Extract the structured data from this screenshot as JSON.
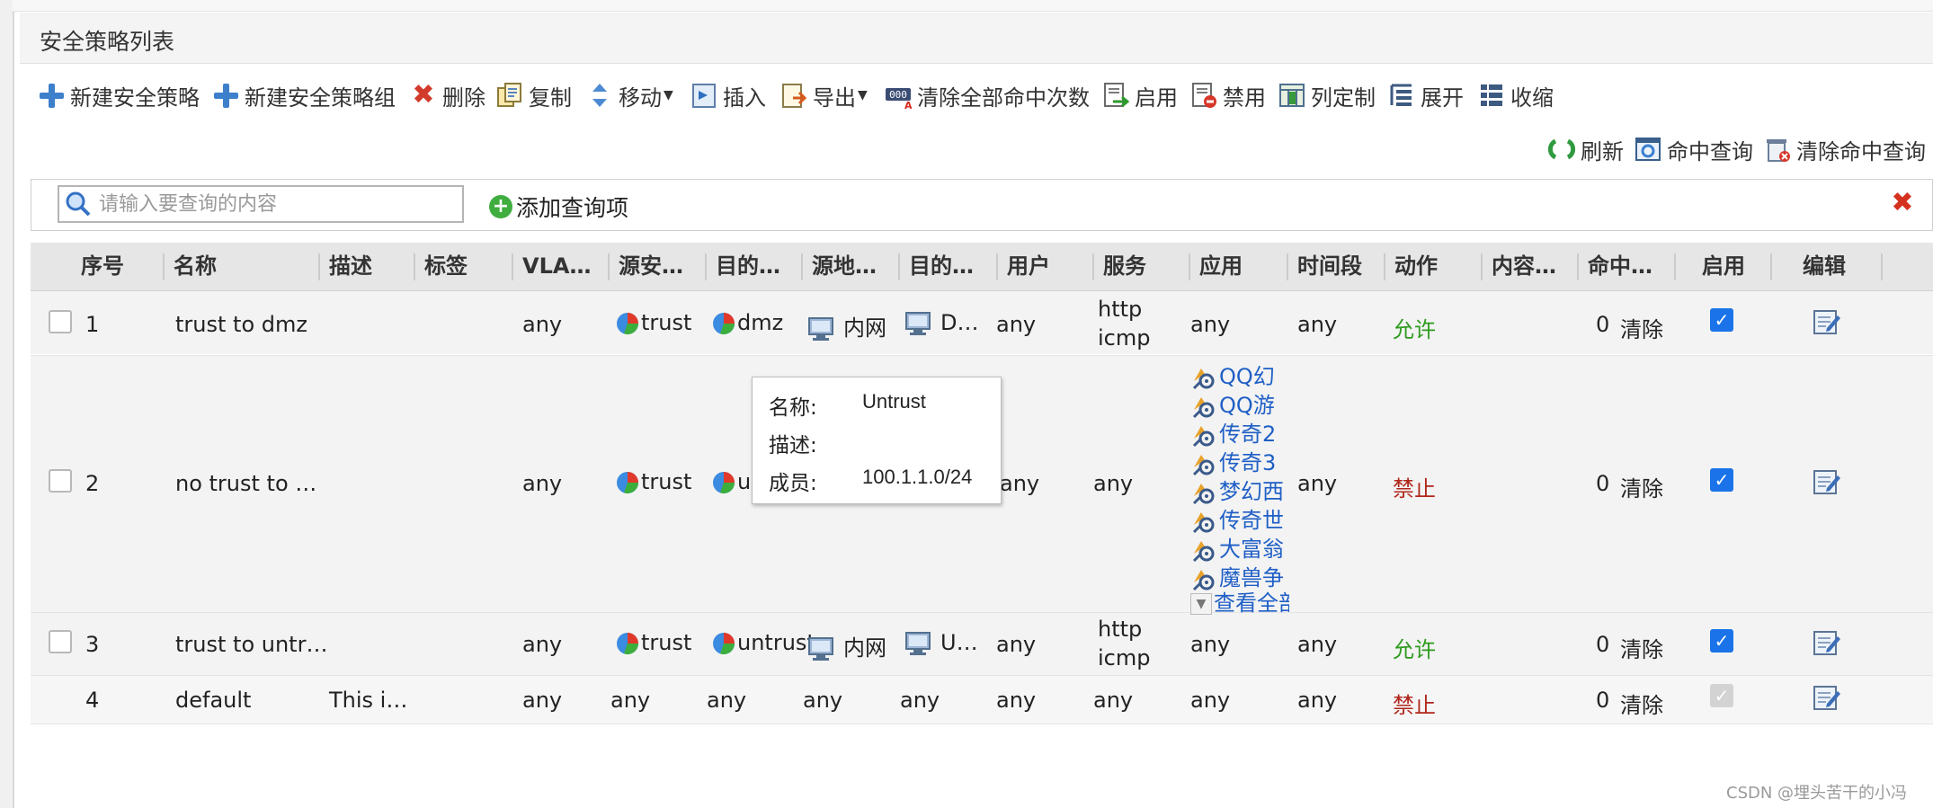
{
  "panel": {
    "title": "安全策略列表"
  },
  "toolbar": {
    "new_policy": "新建安全策略",
    "new_policy_group": "新建安全策略组",
    "delete": "删除",
    "copy": "复制",
    "move": "移动",
    "insert": "插入",
    "export": "导出",
    "clear_all_hits": "清除全部命中次数",
    "enable": "启用",
    "disable": "禁用",
    "customize_columns": "列定制",
    "expand": "展开",
    "collapse": "收缩",
    "refresh": "刷新",
    "hit_query": "命中查询",
    "clear_hit_query": "清除命中查询"
  },
  "search": {
    "placeholder": "请输入要查询的内容",
    "add_query": "添加查询项"
  },
  "columns": [
    "序号",
    "名称",
    "描述",
    "标签",
    "VLA…",
    "源安…",
    "目的…",
    "源地…",
    "目的…",
    "用户",
    "服务",
    "应用",
    "时间段",
    "动作",
    "内容…",
    "命中…",
    "启用",
    "编辑"
  ],
  "rows": [
    {
      "id": "1",
      "name": "trust to dmz",
      "vlan": "any",
      "src_zone": "trust",
      "dst_zone": "dmz",
      "src_addr": "内网",
      "dst_addr": "D…",
      "user": "any",
      "services": [
        "http",
        "icmp"
      ],
      "app": "any",
      "time": "any",
      "action": "允许",
      "hits": "0",
      "clear": "清除",
      "enabled": true
    },
    {
      "id": "2",
      "name": "no trust to …",
      "vlan": "any",
      "src_zone": "trust",
      "dst_zone": "u",
      "user": "any",
      "service": "any",
      "apps": [
        "QQ幻",
        "QQ游",
        "传奇2",
        "传奇3",
        "梦幻西",
        "传奇世",
        "大富翁",
        "魔兽争"
      ],
      "view_all": "查看全部",
      "time": "any",
      "action": "禁止",
      "hits": "0",
      "clear": "清除",
      "enabled": true
    },
    {
      "id": "3",
      "name": "trust to untr…",
      "vlan": "any",
      "src_zone": "trust",
      "dst_zone": "untrust",
      "src_addr": "内网",
      "dst_addr": "U…",
      "user": "any",
      "services": [
        "http",
        "icmp"
      ],
      "app": "any",
      "time": "any",
      "action": "允许",
      "hits": "0",
      "clear": "清除",
      "enabled": true
    },
    {
      "id": "4",
      "name": "default",
      "desc": "This i…",
      "vlan": "any",
      "src_zone": "any",
      "dst_zone": "any",
      "src_addr": "any",
      "dst_addr": "any",
      "user": "any",
      "service": "any",
      "app": "any",
      "time": "any",
      "action": "禁止",
      "hits": "0",
      "clear": "清除",
      "enabled": true
    }
  ],
  "tooltip": {
    "name_label": "名称:",
    "name": "Untrust",
    "desc_label": "描述:",
    "members_label": "成员:",
    "members": "100.1.1.0/24"
  },
  "watermark": "CSDN @埋头苦干的小冯",
  "colors": {
    "link": "#1f5fc6",
    "allow": "#2e9b1e",
    "deny": "#b0261b",
    "header_bg": "#e6e6e6"
  }
}
